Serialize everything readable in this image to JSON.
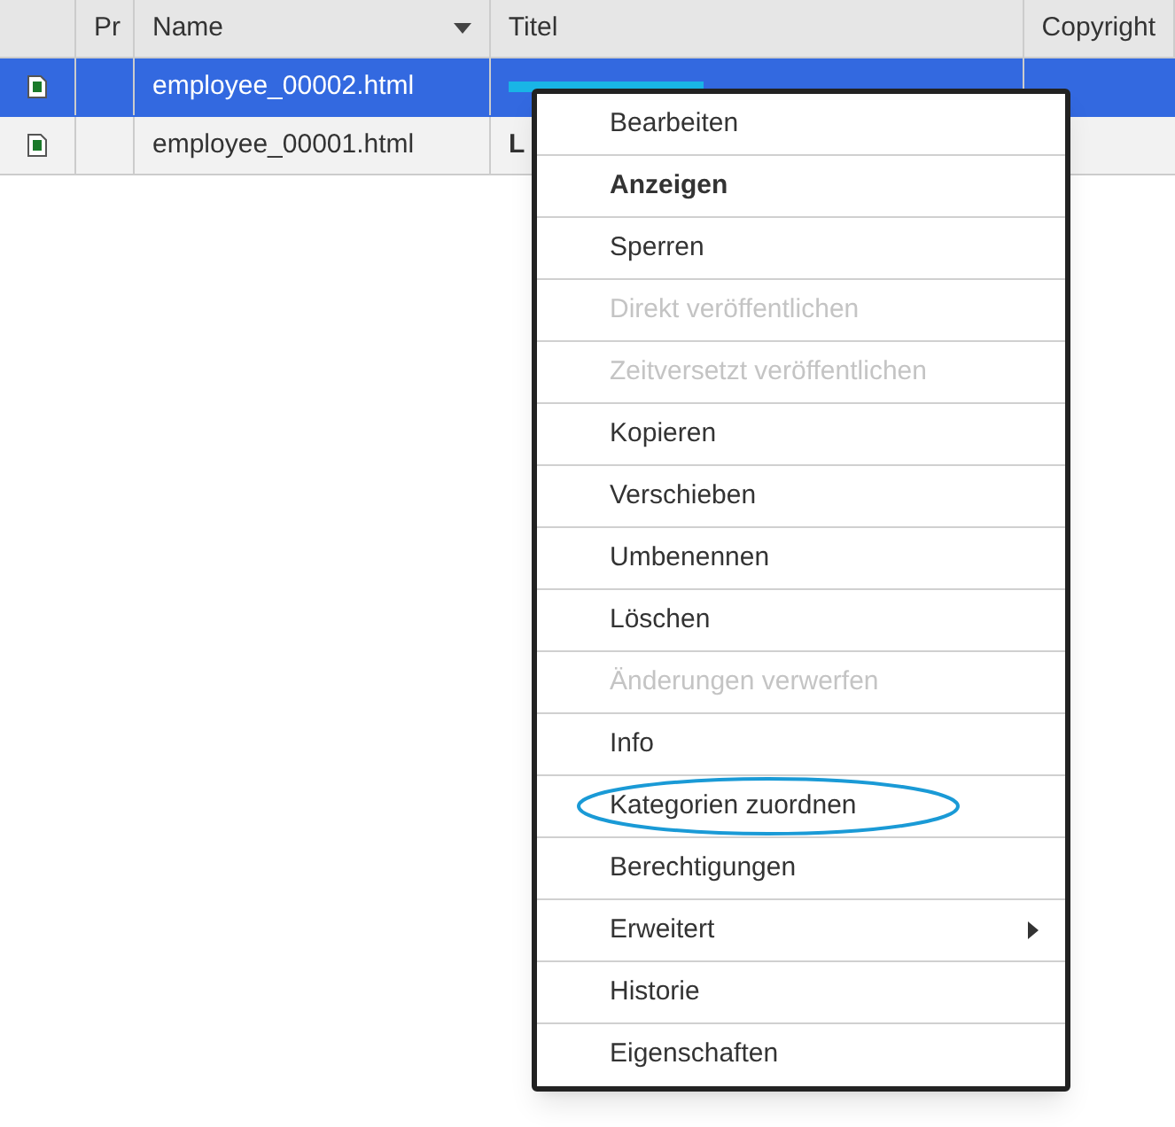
{
  "table": {
    "columns": [
      {
        "label": "Pr",
        "sorted": false
      },
      {
        "label": "Name",
        "sorted": true
      },
      {
        "label": "Titel",
        "sorted": false
      },
      {
        "label": "Copyright",
        "sorted": false
      }
    ],
    "rows": [
      {
        "selected": true,
        "name": "employee_00002.html",
        "title": "",
        "title_redacted": true
      },
      {
        "selected": false,
        "name": "employee_00001.html",
        "title": "L",
        "title_redacted": false
      }
    ]
  },
  "context_menu": {
    "items": [
      {
        "label": "Bearbeiten",
        "kind": "normal",
        "disabled": false,
        "circled": false
      },
      {
        "label": "Anzeigen",
        "kind": "default",
        "disabled": false,
        "circled": false
      },
      {
        "label": "Sperren",
        "kind": "normal",
        "disabled": false,
        "circled": false
      },
      {
        "label": "Direkt veröffentlichen",
        "kind": "normal",
        "disabled": true,
        "circled": false
      },
      {
        "label": "Zeitversetzt veröffentlichen",
        "kind": "normal",
        "disabled": true,
        "circled": false
      },
      {
        "label": "Kopieren",
        "kind": "normal",
        "disabled": false,
        "circled": false
      },
      {
        "label": "Verschieben",
        "kind": "normal",
        "disabled": false,
        "circled": false
      },
      {
        "label": "Umbenennen",
        "kind": "normal",
        "disabled": false,
        "circled": false
      },
      {
        "label": "Löschen",
        "kind": "normal",
        "disabled": false,
        "circled": false
      },
      {
        "label": "Änderungen verwerfen",
        "kind": "normal",
        "disabled": true,
        "circled": false
      },
      {
        "label": "Info",
        "kind": "normal",
        "disabled": false,
        "circled": false
      },
      {
        "label": "Kategorien zuordnen",
        "kind": "normal",
        "disabled": false,
        "circled": true
      },
      {
        "label": "Berechtigungen",
        "kind": "normal",
        "disabled": false,
        "circled": false
      },
      {
        "label": "Erweitert",
        "kind": "submenu",
        "disabled": false,
        "circled": false
      },
      {
        "label": "Historie",
        "kind": "normal",
        "disabled": false,
        "circled": false
      },
      {
        "label": "Eigenschaften",
        "kind": "normal",
        "disabled": false,
        "circled": false
      }
    ]
  }
}
